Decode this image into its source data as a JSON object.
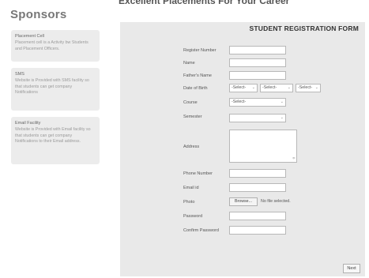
{
  "header": {
    "title": "Excellent Placements For Your Career"
  },
  "sidebar": {
    "title": "Sponsors",
    "cards": [
      {
        "title": "Placement Cell",
        "text": "Placement cell is a Activity bw Students and Placement Officers."
      },
      {
        "title": "SMS",
        "text": "Website is Provided with SMS facility so that students can get company Notifications"
      },
      {
        "title": "Email Facility",
        "text": "Website is Provided with Email facility so that students can get company Notifications to their Email address."
      }
    ]
  },
  "form": {
    "title": "STUDENT REGISTRATION FORM",
    "labels": {
      "register_number": "Register Number",
      "name": "Name",
      "fathers_name": "Father's Name",
      "dob": "Date of Birth",
      "course": "Course",
      "semester": "Semester",
      "address": "Address",
      "phone": "Phone Number",
      "email": "Email id",
      "photo": "Photo",
      "password": "Password",
      "confirm_password": "Confirm Password"
    },
    "dob_selects": [
      "-Select-",
      "-Select-",
      "-Select-"
    ],
    "course_select": "-Select-",
    "semester_select": "",
    "browse_label": "Browse...",
    "file_status": "No file selected.",
    "next_label": "Next"
  }
}
